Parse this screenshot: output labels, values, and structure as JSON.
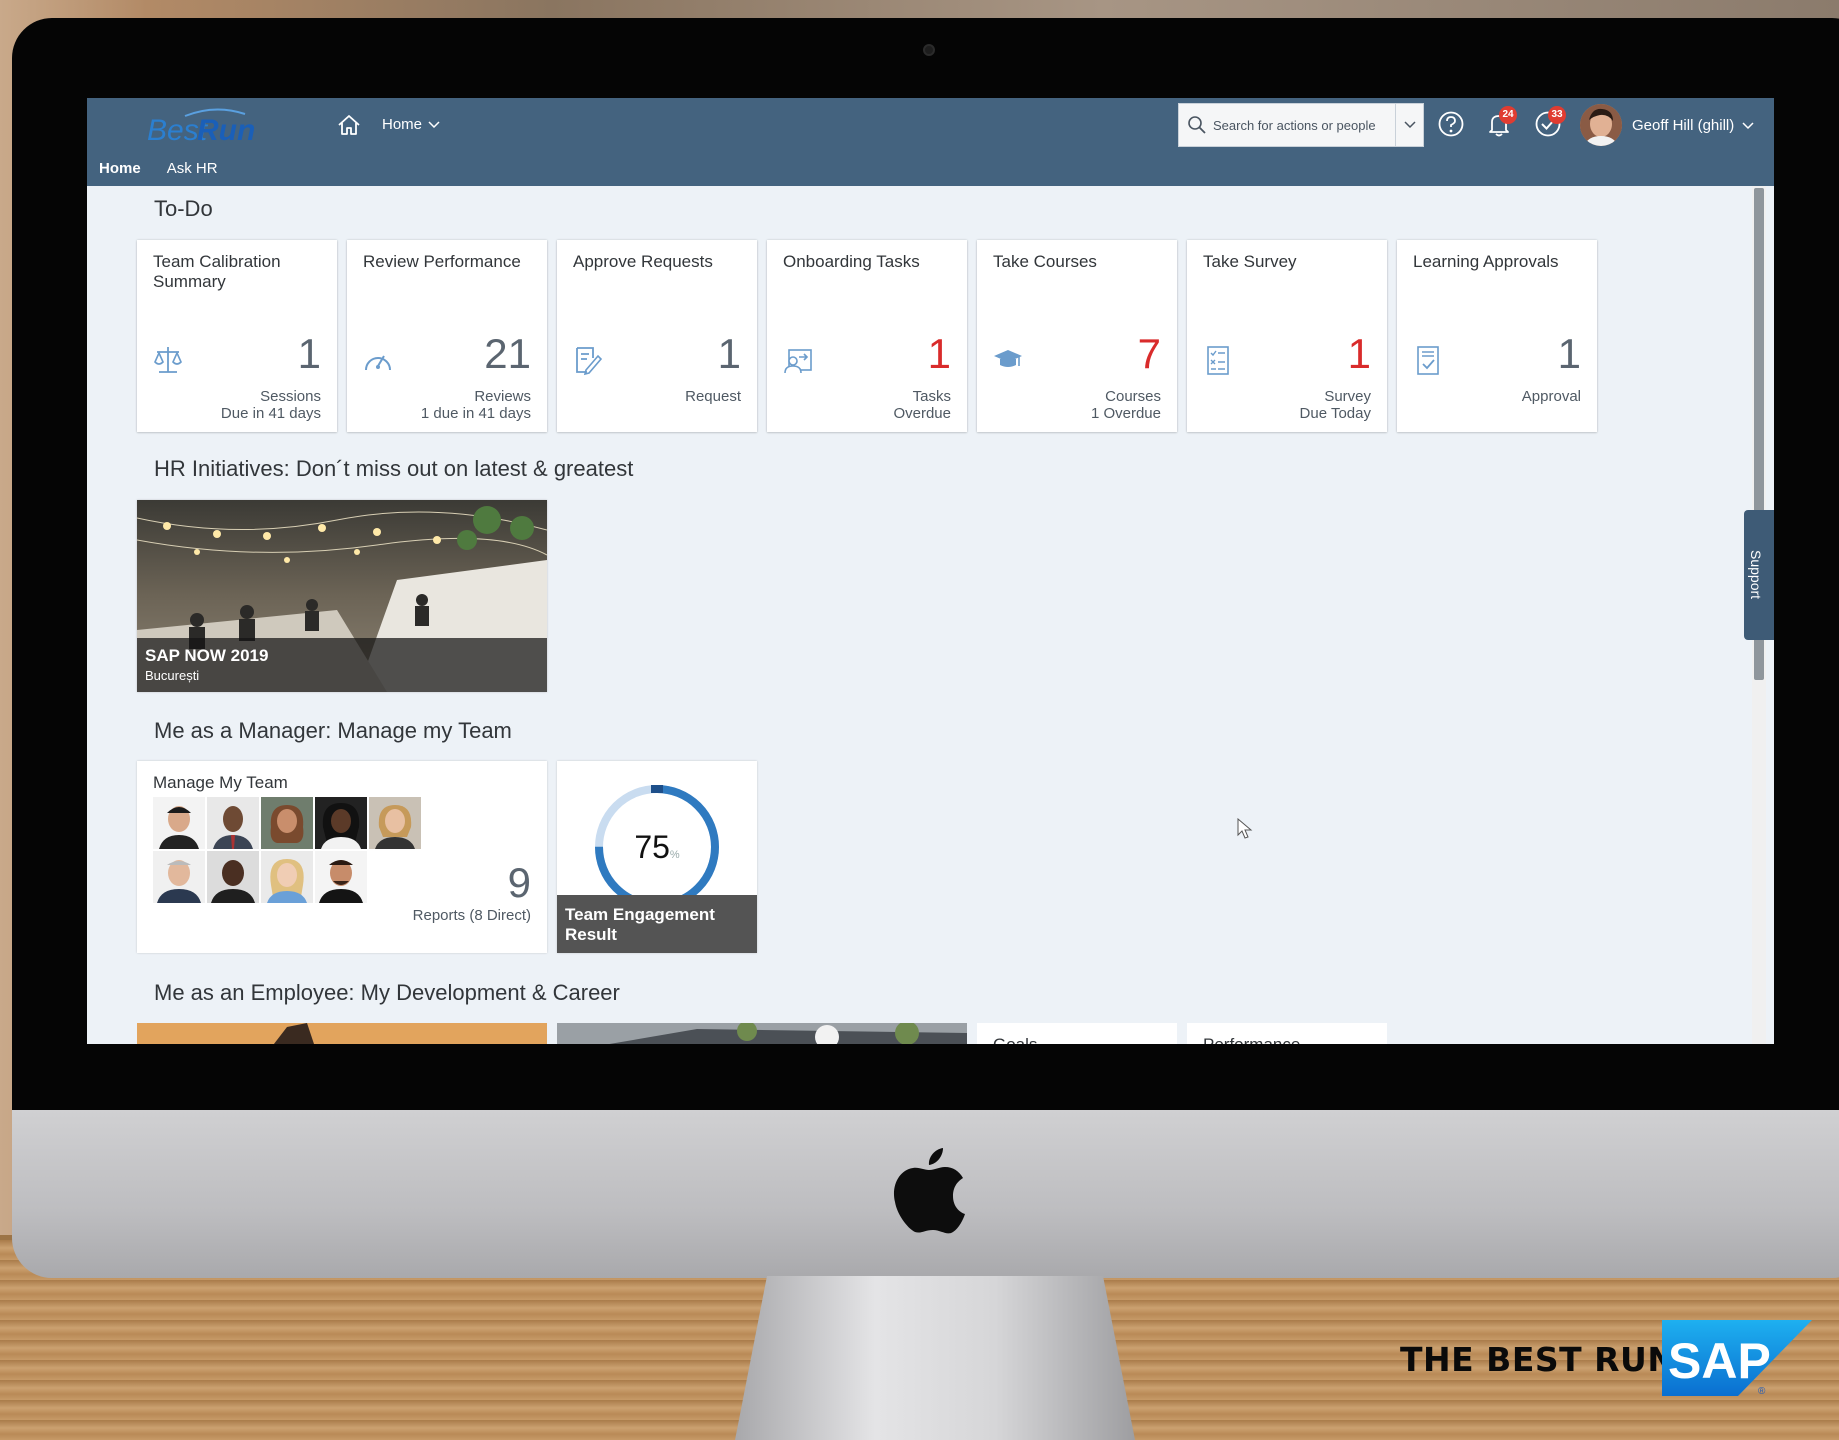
{
  "header": {
    "logo_text": "BestRun",
    "home_menu": "Home",
    "search_placeholder": "Search for actions or people",
    "notifications_count": "24",
    "tasks_count": "33",
    "user_name": "Geoff Hill (ghill)"
  },
  "subnav": {
    "items": [
      "Home",
      "Ask HR"
    ]
  },
  "todo": {
    "title": "To-Do",
    "tiles": [
      {
        "title": "Team Calibration Summary",
        "value": "1",
        "unit1": "Sessions",
        "unit2": "Due in 41 days",
        "icon": "scale-icon",
        "alert": false
      },
      {
        "title": "Review Performance",
        "value": "21",
        "unit1": "Reviews",
        "unit2": "1 due in 41 days",
        "icon": "gauge-icon",
        "alert": false
      },
      {
        "title": "Approve Requests",
        "value": "1",
        "unit1": "Request",
        "unit2": "",
        "icon": "approve-doc-icon",
        "alert": false
      },
      {
        "title": "Onboarding Tasks",
        "value": "1",
        "unit1": "Tasks",
        "unit2": "Overdue",
        "icon": "onboarding-icon",
        "alert": true
      },
      {
        "title": "Take Courses",
        "value": "7",
        "unit1": "Courses",
        "unit2": "1 Overdue",
        "icon": "graduation-cap-icon",
        "alert": true
      },
      {
        "title": "Take Survey",
        "value": "1",
        "unit1": "Survey",
        "unit2": "Due Today",
        "icon": "survey-icon",
        "alert": true
      },
      {
        "title": "Learning Approvals",
        "value": "1",
        "unit1": "Approval",
        "unit2": "",
        "icon": "approval-doc-icon",
        "alert": false
      }
    ]
  },
  "hr": {
    "title": "HR Initiatives: Don´t miss out on latest & greatest",
    "news": {
      "title": "SAP NOW 2019",
      "subtitle": "București"
    }
  },
  "manager": {
    "title": "Me as a Manager: Manage my Team",
    "team": {
      "title": "Manage My Team",
      "value": "9",
      "unit": "Reports (8 Direct)"
    },
    "engagement": {
      "value": "75",
      "unit": "%",
      "percent": 75,
      "label": "Team Engagement Result"
    }
  },
  "employee": {
    "title": "Me as an Employee: My Development & Career",
    "partial_tiles": [
      "Goals",
      "Performance"
    ]
  },
  "support": "Support",
  "branding": "THE BEST RUN",
  "colors": {
    "shell": "#44637f",
    "accent": "#2f7ac0",
    "alert": "#d92b2b"
  }
}
